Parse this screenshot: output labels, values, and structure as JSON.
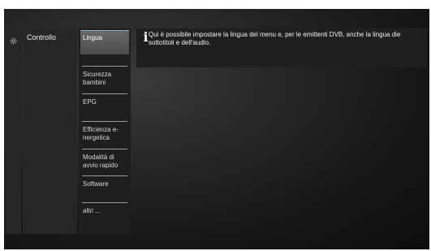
{
  "main_menu": {
    "icon": "gear-icon",
    "item_label": "Controllo"
  },
  "submenu": {
    "items": [
      {
        "label": "Lingua",
        "selected": true
      },
      {
        "label": "Sicurezza bambini",
        "selected": false
      },
      {
        "label": "EPG",
        "selected": false
      },
      {
        "label": "Efficienza e-nergetica",
        "selected": false
      },
      {
        "label": "Modalità di avvio rapido",
        "selected": false
      },
      {
        "label": "Software",
        "selected": false
      },
      {
        "label": "altri ...",
        "selected": false
      }
    ]
  },
  "info_panel": {
    "icon": "info-icon",
    "text": "Qui è possibile impostare la lingua del menu e, per le emittenti DVB, anche la lingua die sottotitoli e dell'audio."
  },
  "colors": {
    "selection_accent": "#8aa8c8",
    "background": "#1a1a1a"
  }
}
